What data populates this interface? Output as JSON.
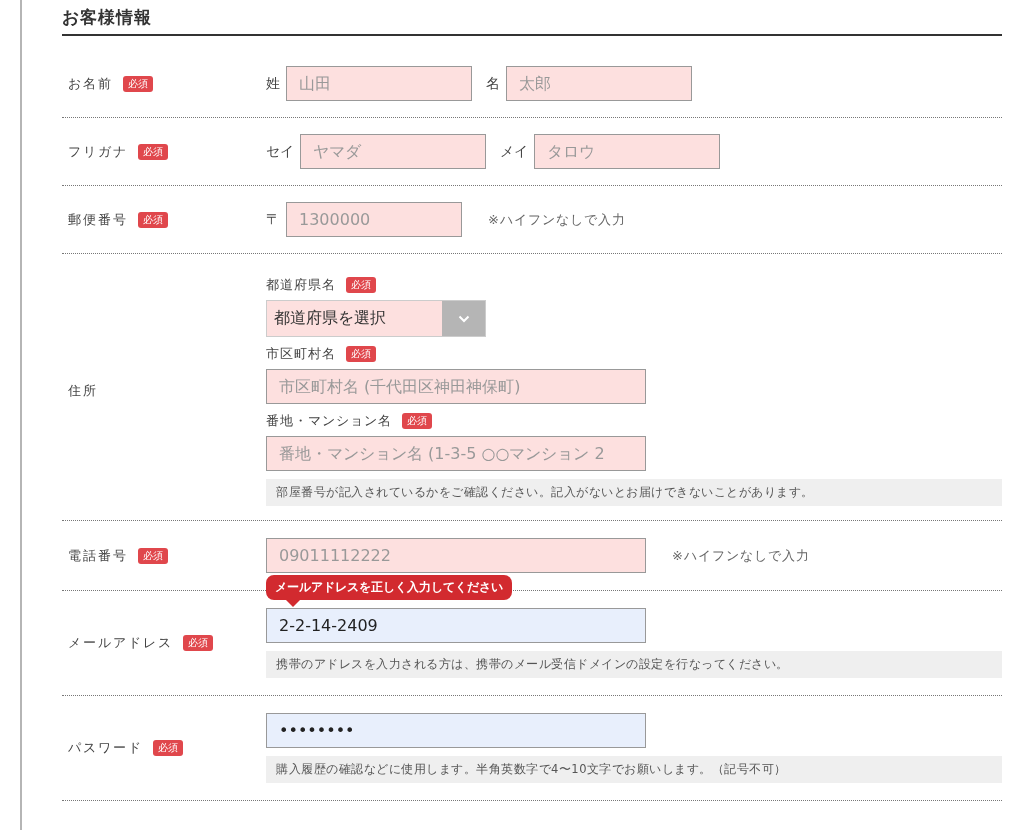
{
  "section_title": "お客様情報",
  "rows": [
    {
      "label": "お名前",
      "badge": "必須",
      "kind": "pair",
      "fields": [
        {
          "prefix": "姓",
          "placeholder": "山田"
        },
        {
          "prefix": "名",
          "placeholder": "太郎"
        }
      ]
    },
    {
      "label": "フリガナ",
      "badge": "必須",
      "kind": "pair",
      "fields": [
        {
          "prefix": "セイ",
          "placeholder": "ヤマダ"
        },
        {
          "prefix": "メイ",
          "placeholder": "タロウ"
        }
      ]
    },
    {
      "label": "郵便番号",
      "badge": "必須",
      "kind": "postal",
      "fields": [
        {
          "prefix": "〒",
          "placeholder": "1300000"
        }
      ],
      "note": "※ハイフンなしで入力"
    },
    {
      "label": "住所",
      "kind": "address",
      "subfields": [
        {
          "label": "都道府県名",
          "badge": "必須",
          "kind": "select",
          "value": "都道府県を選択"
        },
        {
          "label": "市区町村名",
          "badge": "必須",
          "kind": "text",
          "placeholder": "市区町村名 (千代田区神田神保町)"
        },
        {
          "label": "番地・マンション名",
          "badge": "必須",
          "kind": "text",
          "placeholder": "番地・マンション名 (1-3-5 ○○マンション 2"
        }
      ],
      "hint": "部屋番号が記入されているかをご確認ください。記入がないとお届けできないことがあります。"
    },
    {
      "label": "電話番号",
      "badge": "必須",
      "kind": "single",
      "fields": [
        {
          "placeholder": "09011112222"
        }
      ],
      "note": "※ハイフンなしで入力"
    },
    {
      "label": "メールアドレス",
      "badge": "必須",
      "kind": "single",
      "fields": [
        {
          "value": "2-2-14-2409",
          "error": "メールアドレスを正しく入力してください"
        }
      ],
      "hint": "携帯のアドレスを入力される方は、携帯のメール受信ドメインの設定を行なってください。"
    },
    {
      "label": "パスワード",
      "badge": "必須",
      "kind": "single",
      "fields": [
        {
          "value": "••••••••"
        }
      ],
      "hint": "購入履歴の確認などに使用します。半角英数字で4〜10文字でお願いします。（記号不可）"
    }
  ]
}
